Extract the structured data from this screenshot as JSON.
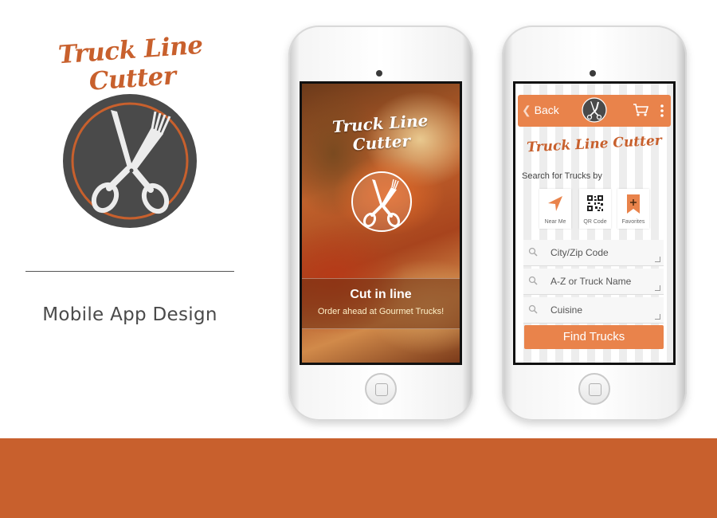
{
  "brand": {
    "name": "Truck Line Cutter",
    "tagline": "Mobile App Design"
  },
  "colors": {
    "accent": "#c8602d",
    "accent_light": "#e9834b",
    "badge_dark": "#4a4a4a"
  },
  "splash_screen": {
    "title": "Truck Line Cutter",
    "headline": "Cut in line",
    "subheadline": "Order ahead at Gourmet Trucks!",
    "logo_icon": "knife-fork-scissors-icon"
  },
  "search_screen": {
    "back_label": "Back",
    "brand_title": "Truck Line Cutter",
    "search_label": "Search for Trucks by",
    "options": [
      {
        "label": "Near Me",
        "icon": "location-arrow-icon"
      },
      {
        "label": "QR Code",
        "icon": "qr-code-icon"
      },
      {
        "label": "Favorites",
        "icon": "bookmark-plus-icon"
      }
    ],
    "fields": [
      {
        "placeholder": "City/Zip Code"
      },
      {
        "placeholder": "A-Z or Truck Name"
      },
      {
        "placeholder": "Cuisine"
      }
    ],
    "find_button": "Find Trucks"
  }
}
